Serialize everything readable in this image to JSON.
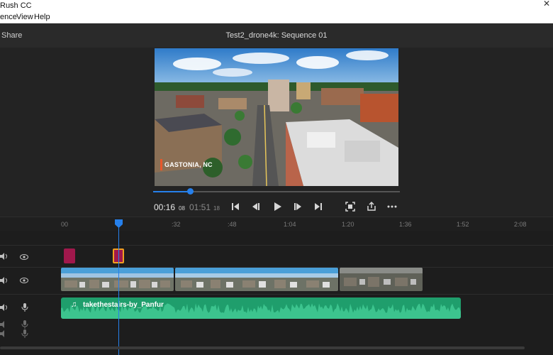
{
  "window": {
    "title": "Rush CC",
    "close_glyph": "✕"
  },
  "menu": {
    "items": [
      "ence",
      "View",
      "Help"
    ]
  },
  "header": {
    "share_label": "Share",
    "sequence_title": "Test2_drone4k: Sequence 01"
  },
  "monitor": {
    "caption": "GASTONIA, NC",
    "playhead_progress": 0.15,
    "timecode_current": "00:16",
    "timecode_current_frames": "08",
    "timecode_duration": "01:51",
    "timecode_duration_frames": "18",
    "controls": [
      "go-to-start-icon",
      "step-back-icon",
      "play-icon",
      "step-forward-icon",
      "go-to-end-icon",
      "fit-frame-icon",
      "export-frame-icon",
      "more-icon"
    ]
  },
  "timeline": {
    "ticks": [
      "00",
      ":32",
      ":48",
      "1:04",
      "1:20",
      "1:36",
      "1:52",
      "2:08"
    ],
    "audio_clip_label": "takethestairs-by_Panfur",
    "tracks": [
      "title-track",
      "video-track",
      "audio-track",
      "audio-track-2",
      "audio-track-3"
    ]
  },
  "colors": {
    "accent": "#2680eb",
    "title_clip": "#a0184c",
    "selected_border": "#f0a020",
    "video_header": "#4a9fd8",
    "audio_clip": "#1f9e6c"
  }
}
